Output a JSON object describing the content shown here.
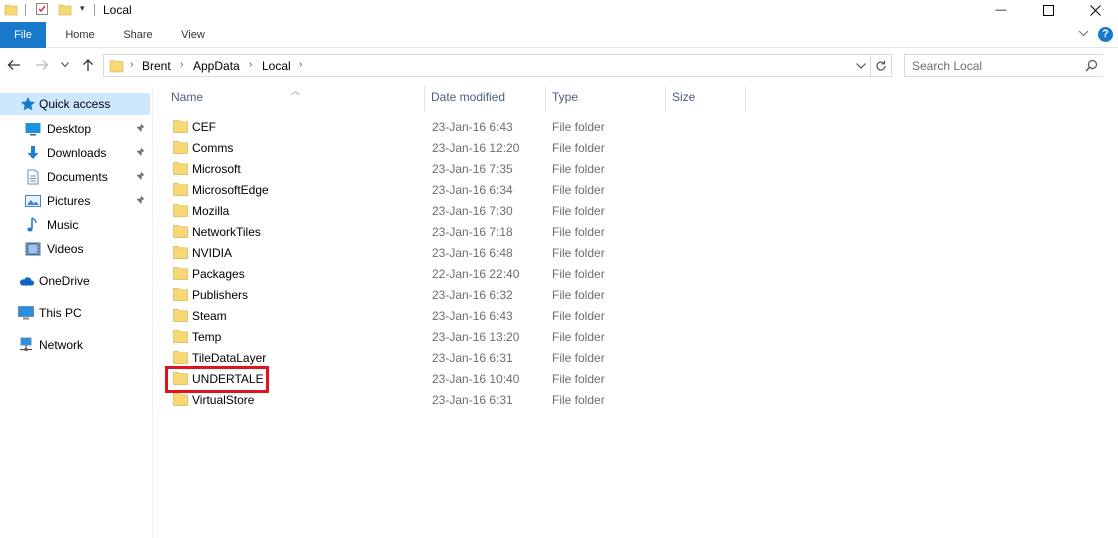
{
  "window": {
    "title": "Local",
    "minimize_glyph": "—",
    "maximize_glyph": "☐",
    "close_glyph": "✕"
  },
  "ribbon": {
    "tabs": [
      "File",
      "Home",
      "Share",
      "View"
    ],
    "help_glyph": "?"
  },
  "address": {
    "crumbs": [
      "Brent",
      "AppData",
      "Local"
    ],
    "search_placeholder": "Search Local"
  },
  "nav_pane": {
    "quick_access": "Quick access",
    "items": [
      {
        "label": "Desktop",
        "icon": "desktop-icon",
        "pinned": true
      },
      {
        "label": "Downloads",
        "icon": "downloads-icon",
        "pinned": true
      },
      {
        "label": "Documents",
        "icon": "documents-icon",
        "pinned": true
      },
      {
        "label": "Pictures",
        "icon": "pictures-icon",
        "pinned": true
      },
      {
        "label": "Music",
        "icon": "music-icon",
        "pinned": false
      },
      {
        "label": "Videos",
        "icon": "videos-icon",
        "pinned": false
      }
    ],
    "onedrive": "OneDrive",
    "this_pc": "This PC",
    "network": "Network"
  },
  "columns": {
    "name": "Name",
    "date_modified": "Date modified",
    "type": "Type",
    "size": "Size"
  },
  "files": [
    {
      "name": "CEF",
      "date": "23-Jan-16 6:43",
      "type": "File folder"
    },
    {
      "name": "Comms",
      "date": "23-Jan-16 12:20",
      "type": "File folder"
    },
    {
      "name": "Microsoft",
      "date": "23-Jan-16 7:35",
      "type": "File folder"
    },
    {
      "name": "MicrosoftEdge",
      "date": "23-Jan-16 6:34",
      "type": "File folder"
    },
    {
      "name": "Mozilla",
      "date": "23-Jan-16 7:30",
      "type": "File folder"
    },
    {
      "name": "NetworkTiles",
      "date": "23-Jan-16 7:18",
      "type": "File folder"
    },
    {
      "name": "NVIDIA",
      "date": "23-Jan-16 6:48",
      "type": "File folder"
    },
    {
      "name": "Packages",
      "date": "22-Jan-16 22:40",
      "type": "File folder"
    },
    {
      "name": "Publishers",
      "date": "23-Jan-16 6:32",
      "type": "File folder"
    },
    {
      "name": "Steam",
      "date": "23-Jan-16 6:43",
      "type": "File folder"
    },
    {
      "name": "Temp",
      "date": "23-Jan-16 13:20",
      "type": "File folder"
    },
    {
      "name": "TileDataLayer",
      "date": "23-Jan-16 6:31",
      "type": "File folder"
    },
    {
      "name": "UNDERTALE",
      "date": "23-Jan-16 10:40",
      "type": "File folder"
    },
    {
      "name": "VirtualStore",
      "date": "23-Jan-16 6:31",
      "type": "File folder"
    }
  ],
  "colors": {
    "file_tab": "#1979ca",
    "quick_access_selected": "#cce8ff",
    "highlight_box": "#e0131f",
    "folder": "#f8d775"
  }
}
